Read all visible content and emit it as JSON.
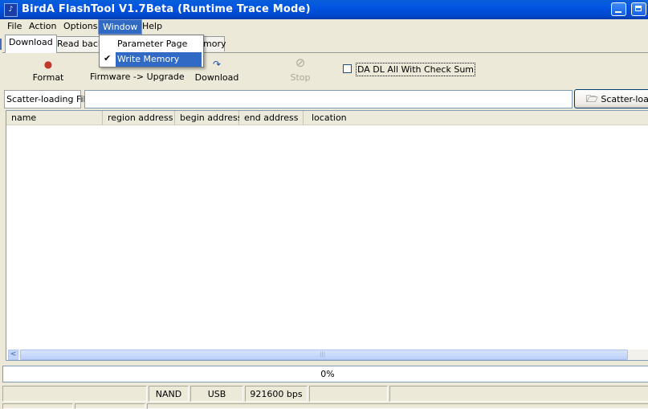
{
  "window": {
    "title": "BirdA FlashTool V1.7Beta (Runtime Trace Mode)",
    "icon": "app-icon"
  },
  "menu": {
    "items": [
      "File",
      "Action",
      "Options",
      "Window",
      "Help"
    ],
    "open": "Window",
    "dropdown": {
      "items": [
        {
          "label": "Parameter Page",
          "checked": false
        },
        {
          "label": "Write Memory",
          "checked": true
        }
      ]
    }
  },
  "tabs": {
    "items": [
      "Download",
      "Read back",
      "mory"
    ],
    "active": "Download"
  },
  "toolbar": {
    "format": "Format",
    "firmware_upgrade": "Firmware -> Upgrade",
    "download": "Download",
    "stop": "Stop",
    "checksum_label": "DA DL All With Check Sum",
    "checksum_checked": false
  },
  "scatter": {
    "label": "Scatter-loading File",
    "value": "",
    "button": "Scatter-load"
  },
  "table": {
    "columns": [
      "name",
      "region address",
      "begin address",
      "end address",
      "location"
    ],
    "rows": []
  },
  "progress": {
    "text": "0%",
    "value": 0
  },
  "statusbar": {
    "cells": [
      "",
      "NAND",
      "USB",
      "921600 bps",
      "",
      ""
    ]
  },
  "colors": {
    "titlebar": "#0054e3",
    "menu_highlight": "#316ac5",
    "face": "#ece9d8"
  }
}
